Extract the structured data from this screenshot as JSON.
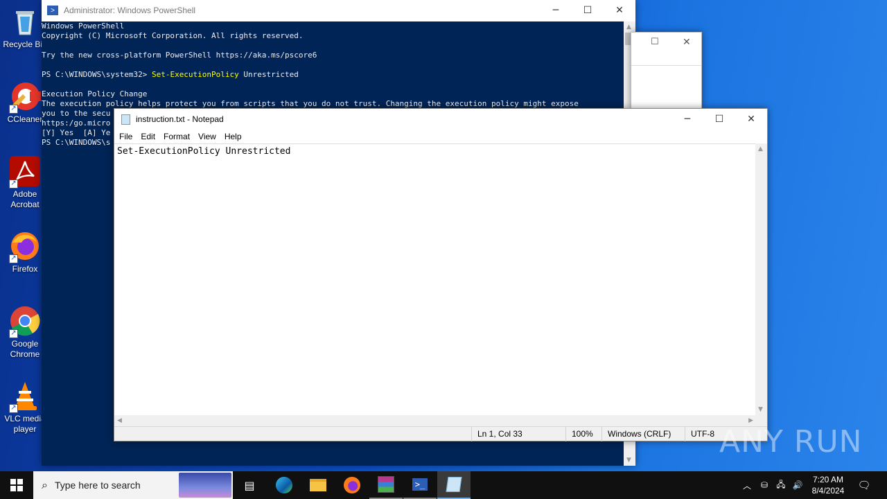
{
  "desktop": {
    "icons": [
      {
        "label": "Recycle Bin"
      },
      {
        "label": "CCleaner"
      },
      {
        "label": "Adobe Acrobat"
      },
      {
        "label": "Firefox"
      },
      {
        "label": "Google Chrome"
      },
      {
        "label": "VLC media player"
      }
    ]
  },
  "powershell": {
    "title": "Administrator: Windows PowerShell",
    "lines": [
      "Windows PowerShell",
      "Copyright (C) Microsoft Corporation. All rights reserved.",
      "",
      "Try the new cross-platform PowerShell https://aka.ms/pscore6",
      ""
    ],
    "prompt": "PS C:\\WINDOWS\\system32> ",
    "command": "Set-ExecutionPolicy",
    "command_arg": " Unrestricted",
    "output_lines": [
      "",
      "Execution Policy Change",
      "The execution policy helps protect you from scripts that you do not trust. Changing the execution policy might expose",
      "you to the secu",
      "https:/go.micro",
      "[Y] Yes  [A] Ye",
      "PS C:\\WINDOWS\\s"
    ]
  },
  "notepad": {
    "title": "instruction.txt - Notepad",
    "menu": [
      "File",
      "Edit",
      "Format",
      "View",
      "Help"
    ],
    "content": "Set-ExecutionPolicy Unrestricted",
    "status": {
      "position": "Ln 1, Col 33",
      "zoom": "100%",
      "line_ending": "Windows (CRLF)",
      "encoding": "UTF-8"
    }
  },
  "watermark": "ANY RUN",
  "taskbar": {
    "search_placeholder": "Type here to search",
    "time": "7:20 AM",
    "date": "8/4/2024"
  },
  "colors": {
    "ps_background": "#012456",
    "ps_command": "#ffff00",
    "desktop_blue": "#0b4fc8"
  }
}
